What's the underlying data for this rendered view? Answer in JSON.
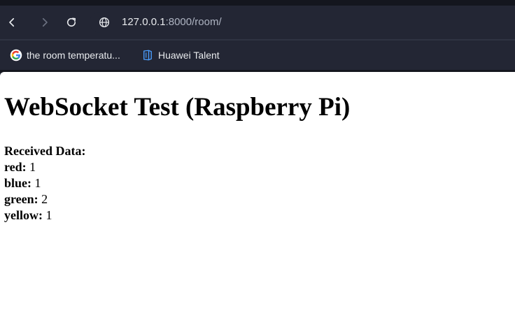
{
  "browser": {
    "url_host": "127.0.0.1",
    "url_rest": ":8000/room/",
    "bookmarks": [
      {
        "label": "the room temperatu...",
        "icon": "google-icon"
      },
      {
        "label": "Huawei Talent",
        "icon": "huawei-talent-icon"
      }
    ]
  },
  "page": {
    "title": "WebSocket Test (Raspberry Pi)",
    "received_label": "Received Data:",
    "items": [
      {
        "key": "red:",
        "value": "1"
      },
      {
        "key": "blue:",
        "value": "1"
      },
      {
        "key": "green:",
        "value": "2"
      },
      {
        "key": "yellow:",
        "value": "1"
      }
    ]
  },
  "colors": {
    "chrome_bg": "#232634",
    "page_bg": "#ffffff",
    "text": "#000000"
  }
}
